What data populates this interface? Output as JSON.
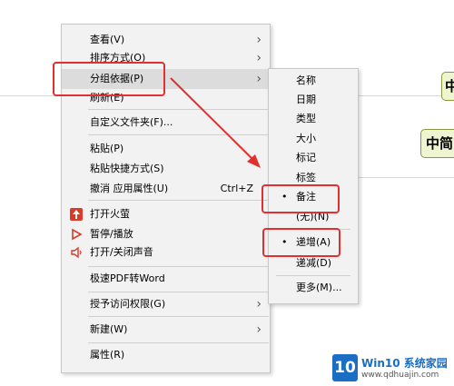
{
  "context_menu": {
    "items": [
      {
        "label": "查看(V)",
        "arrow": "›"
      },
      {
        "label": "排序方式(O)",
        "arrow": "›"
      },
      {
        "label": "分组依据(P)",
        "arrow": "›"
      },
      {
        "label": "刷新(E)"
      },
      {
        "label": "自定义文件夹(F)..."
      },
      {
        "label": "粘贴(P)"
      },
      {
        "label": "粘贴快捷方式(S)"
      },
      {
        "label": "撤消 应用属性(U)",
        "shortcut": "Ctrl+Z"
      },
      {
        "label": "打开火萤"
      },
      {
        "label": "暂停/播放"
      },
      {
        "label": "打开/关闭声音"
      },
      {
        "label": "极速PDF转Word"
      },
      {
        "label": "授予访问权限(G)",
        "arrow": "›"
      },
      {
        "label": "新建(W)",
        "arrow": "›"
      },
      {
        "label": "属性(R)"
      }
    ]
  },
  "submenu": {
    "items": [
      {
        "label": "名称"
      },
      {
        "label": "日期"
      },
      {
        "label": "类型"
      },
      {
        "label": "大小"
      },
      {
        "label": "标记"
      },
      {
        "label": "标签"
      },
      {
        "label": "备注",
        "bullet": "•"
      },
      {
        "label": "(无)(N)"
      },
      {
        "label": "递增(A)",
        "bullet": "•"
      },
      {
        "label": "递减(D)"
      },
      {
        "label": "更多(M)..."
      }
    ]
  },
  "background": {
    "card1": "中",
    "card2": "中简"
  },
  "watermark": {
    "logo": "10",
    "title": "Win10 系统家园",
    "url": "www.qdhuajin.com"
  },
  "colors": {
    "annotation_red": "#e03030",
    "firefly_red": "#d83b2a",
    "watermark_blue": "#1a6fc4"
  }
}
